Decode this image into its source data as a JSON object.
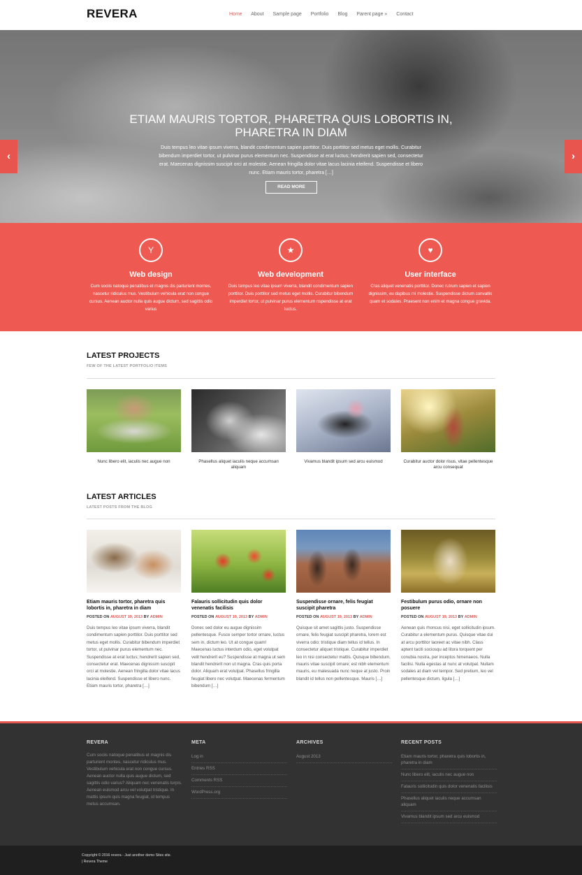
{
  "header": {
    "logo": "REVERA",
    "nav": [
      "Home",
      "About",
      "Sample page",
      "Portfolio",
      "Blog",
      "Parent page »",
      "Contact"
    ],
    "active_color": "#e8554e"
  },
  "hero": {
    "title": "ETIAM MAURIS TORTOR, PHARETRA QUIS LOBORTIS IN, PHARETRA IN DIAM",
    "text": "Duis tempus leo vitae ipsum viverra, blandit condimentum sapien porttitor. Duis porttitor sed metus eget mollis. Curabitur bibendum imperdiet tortor, ut pulvinar purus elementum nec. Suspendisse at erat luctus; hendrerit sapien sed, consectetur erat. Maecenas dignissim suscipit orci at molestie. Aenean fringilla dolor vitae lacus lacinia eleifend. Suspendisse et libero nunc. Etiam mauris tortor, pharetra […]",
    "button": "READ MORE",
    "prev_icon": "chevron-left-icon",
    "next_icon": "chevron-right-icon"
  },
  "features": [
    {
      "icon": "cocktail-icon",
      "title": "Web design",
      "text": "Cum sociis natoque penatibus et magnis dis parturient montes, nascetur ridiculus mus. Vestibulum vehicula erat non congue cursus. Aenean auctor nulla quis augue dictum, sed sagittis odio varius"
    },
    {
      "icon": "star-icon",
      "title": "Web development",
      "text": "Duis tempus leo vitae ipsum viverra, blandit condimentum sapien porttitor. Duis porttitor sed metus eget mollis. Curabitur bibendum imperdiet tortor, ut pulvinar purus elementum nspendisse at erat luctus."
    },
    {
      "icon": "heart-icon",
      "title": "User interface",
      "text": "Cras aliquet venenatis porttitor. Donec rutrum sapien et sapien dignissim, eu dapibus mi molestie. Suspendisse dictum convallis quam et sodales. Praesent non enim et magna congue gravida."
    }
  ],
  "projects": {
    "title": "LATEST PROJECTS",
    "subtitle": "FEW OF THE LATEST PORTFOLIO ITEMS",
    "items": [
      "Nunc libero elit, iaculis nec augue non",
      "Phasellus aliquet iaculis neque accumsan aliquam",
      "Vivamus blandit ipsum sed arcu euismod",
      "Curabitur auctor dolor risus, vitae pellentesque arcu consequat"
    ]
  },
  "articles": {
    "title": "LATEST ARTICLES",
    "subtitle": "LATEST POSTS FROM THE BLOG",
    "items": [
      {
        "title": "Etiam mauris tortor, pharetra quis lobortis in, pharetra in diam",
        "posted": "POSTED ON",
        "date": "AUGUST 19, 2013",
        "by": "BY",
        "author": "ADMIN",
        "text": "Duis tempus leo vitae ipsum viverra, blandit condimentum sapien porttitor. Duis porttitor sed metus eget mollis. Curabitur bibendum imperdiet tortor, ut pulvinar purus elementum nec. Suspendisse at erat luctus; hendrerit sapien sed, consectetur erat. Maecenas dignissim suscipit orci at molestie. Aenean fringilla dolor vitae lacus lacinia eleifend. Suspendisse et libero nunc. Etiam mauris tortor, pharetra […]"
      },
      {
        "title": "Falauris sollicitudin quis dolor venenatis facilisis",
        "posted": "POSTED ON",
        "date": "AUGUST 19, 2013",
        "by": "BY",
        "author": "ADMIN",
        "text": "Donec sed dolor eu augue dignissim pellentesque. Fusce semper tortor ornare, luctus sem in, dictum leo. Ut at congue quam! Maecenas luctus interdum odio, eget volutpat velit hendrerit eu? Suspendisse at magna ut sem blandit hendrerit non ut magna. Cras quis porta dolor. Aliquam erat volutpat. Phasellus fringilla feugiat libero nec volutpat. Maecenas fermentum bibendum […]"
      },
      {
        "title": "Suspendisse ornare, felis feugiat suscipit pharetra",
        "posted": "POSTED ON",
        "date": "AUGUST 19, 2013",
        "by": "BY",
        "author": "ADMIN",
        "text": "Quisque sit amet sagittis justo. Suspendisse ornare, felis feugiat suscipit pharetra, lorem est viverra odio; tristique diam tellus id tellus. In consectetur aliquet tristique. Curabitur imperdiet leo in nisi consectetur mattis. Quisque bibendum, mauris vitae suscipit ornare; est nibh elementum mauris, eu malesuada nunc neque at justo. Proin blandit id tellus non pellentesque. Mauris […]"
      },
      {
        "title": "Festibulum purus odio, ornare non posuere",
        "posted": "POSTED ON",
        "date": "AUGUST 19, 2013",
        "by": "BY",
        "author": "ADMIN",
        "text": "Aenean quis rhoncus nisi, eget sollicitudin ipsum. Curabitur a elementum purus. Quisque vitae dui at arcu porttitor laoreet ac vitae nibh. Class aptent taciti sociosqu ad litora torquent per conubia nostra, per inceptos himenaeos. Nulla facilisi. Nulla egestas at nunc at volutpat. Nullam sodales at diam vel tempor. Sed pretium, leo vel pellentesque dictum, ligula […]"
      }
    ]
  },
  "footer": {
    "about": {
      "title": "REVERA",
      "text": "Cum sociis natoque penatibus et magnis dis parturient montes, nascetur ridiculus mus. Vestibulum vehicula erat non congue cursus. Aenean auctor nulla quis augue dictum, sed sagittis odio varius? Aliquam nec venenatis turpis. Aenean euismod arcu vel volutpat tristique. In mattis ipsum quis magna feugiat, id tempus metus accumsan."
    },
    "meta": {
      "title": "META",
      "links": [
        "Log in",
        "Entries RSS",
        "Comments RSS",
        "WordPress.org"
      ]
    },
    "archives": {
      "title": "ARCHIVES",
      "links": [
        "August 2013"
      ]
    },
    "recent": {
      "title": "RECENT POSTS",
      "links": [
        "Etiam mauris tortor, pharetra quis lobortis in, pharetra in diam",
        "Nunc libero elit, iaculis nec augue non",
        "Falauris sollicitudin quis dolor venenatis facilisis",
        "Phasellus aliquet iaculis neque accumsan aliquam",
        "Vivamus blandit ipsum sed arcu euismod"
      ]
    },
    "copyright": "Copyright © 2016 revera - Just another demo Sites site.",
    "credit": "| Revera Theme"
  }
}
